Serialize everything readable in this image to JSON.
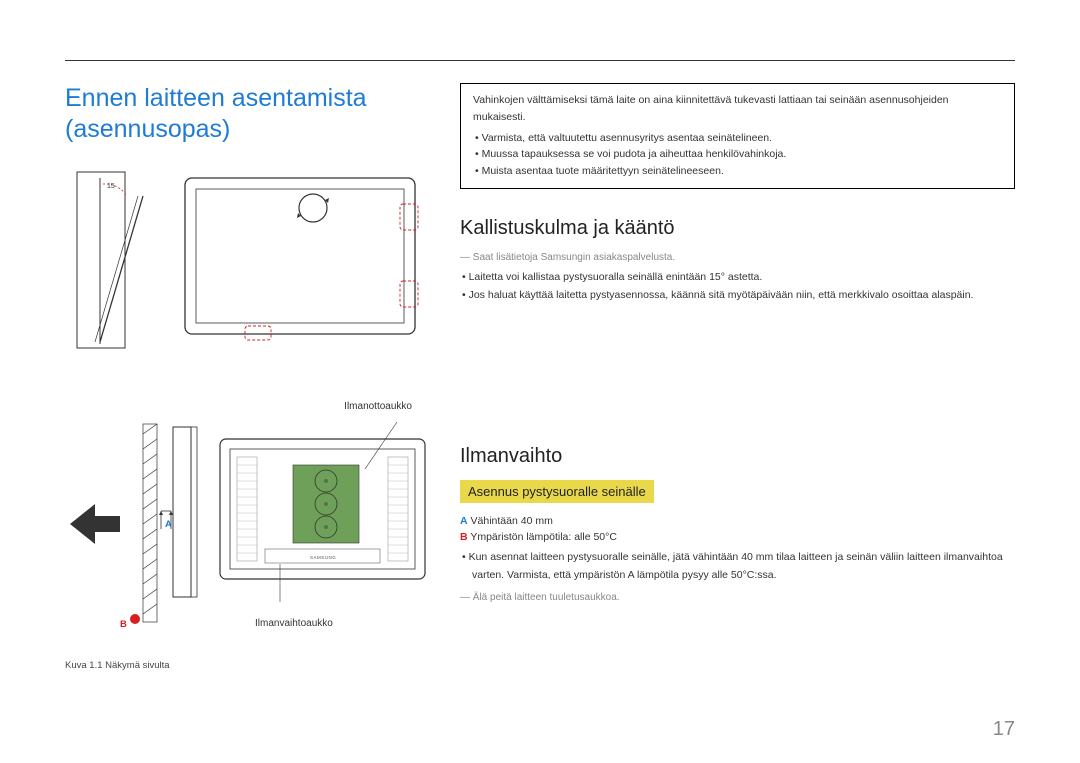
{
  "title": "Ennen laitteen asentamista (asennusopas)",
  "warning": {
    "lead": "Vahinkojen välttämiseksi tämä laite on aina kiinnitettävä tukevasti lattiaan tai seinään asennusohjeiden mukaisesti.",
    "items": [
      "Varmista, että valtuutettu asennusyritys asentaa seinätelineen.",
      "Muussa tapauksessa se voi pudota ja aiheuttaa henkilövahinkoja.",
      "Muista asentaa tuote määritettyyn seinätelineeseen."
    ]
  },
  "section1": {
    "heading": "Kallistuskulma ja kääntö",
    "note": "Saat lisätietoja Samsungin asiakaspalvelusta.",
    "bullets": [
      "Laitetta voi kallistaa pystysuoralla seinällä enintään 15° astetta.",
      "Jos haluat käyttää laitetta pystyasennossa, käännä sitä myötäpäivään niin, että merkkivalo osoittaa alaspäin."
    ]
  },
  "fig1": {
    "angle_label": "15"
  },
  "section2": {
    "heading": "Ilmanvaihto",
    "subheading": "Asennus pystysuoralle seinälle",
    "spec_a_label": "A",
    "spec_a_text": "Vähintään 40 mm",
    "spec_b_label": "B",
    "spec_b_text": "Ympäristön lämpötila: alle 50°C",
    "bullets": [
      "Kun asennat laitteen pystysuoralle seinälle, jätä vähintään 40 mm tilaa laitteen ja seinän väliin laitteen ilmanvaihtoa varten. Varmista, että ympäristön A lämpötila pysyy alle 50°C:ssa."
    ],
    "note": "Älä peitä laitteen tuuletusaukkoa."
  },
  "fig2": {
    "label_top": "Ilmanottoaukko",
    "label_bottom": "Ilmanvaihtoaukko",
    "a": "A",
    "b": "B",
    "caption": "Kuva 1.1 Näkymä sivulta",
    "brand": "SAMSUNG"
  },
  "page_number": "17"
}
